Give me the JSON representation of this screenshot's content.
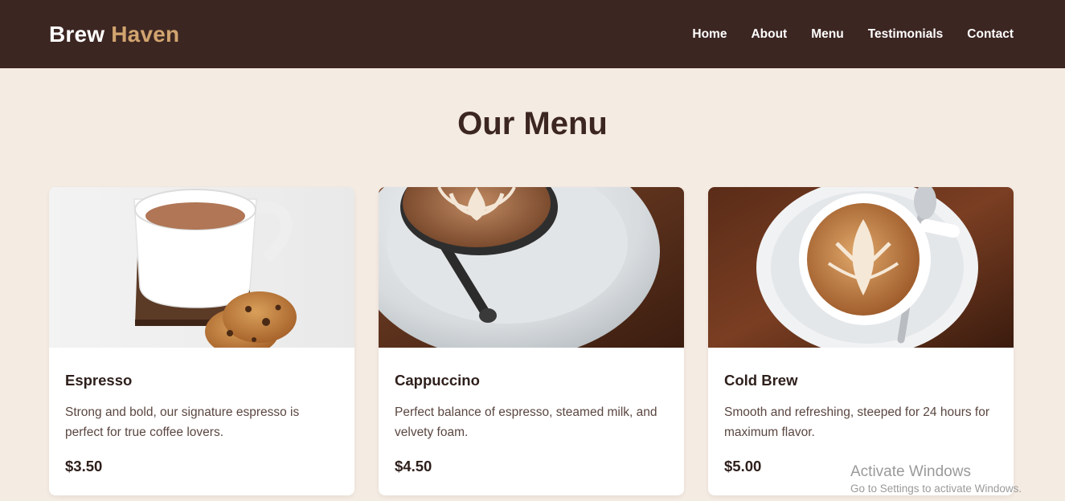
{
  "brand": {
    "part1": "Brew",
    "part2": "Haven"
  },
  "nav": {
    "items": [
      {
        "label": "Home"
      },
      {
        "label": "About"
      },
      {
        "label": "Menu"
      },
      {
        "label": "Testimonials"
      },
      {
        "label": "Contact"
      }
    ]
  },
  "menu": {
    "title": "Our Menu",
    "items": [
      {
        "name": "Espresso",
        "description": "Strong and bold, our signature espresso is perfect for true coffee lovers.",
        "price": "$3.50"
      },
      {
        "name": "Cappuccino",
        "description": "Perfect balance of espresso, steamed milk, and velvety foam.",
        "price": "$4.50"
      },
      {
        "name": "Cold Brew",
        "description": "Smooth and refreshing, steeped for 24 hours for maximum flavor.",
        "price": "$5.00"
      }
    ]
  },
  "watermark": {
    "title": "Activate Windows",
    "subtitle": "Go to Settings to activate Windows."
  },
  "colors": {
    "navbar_bg": "#3c2622",
    "accent": "#d2a46f",
    "page_bg": "#f4ebe2"
  }
}
